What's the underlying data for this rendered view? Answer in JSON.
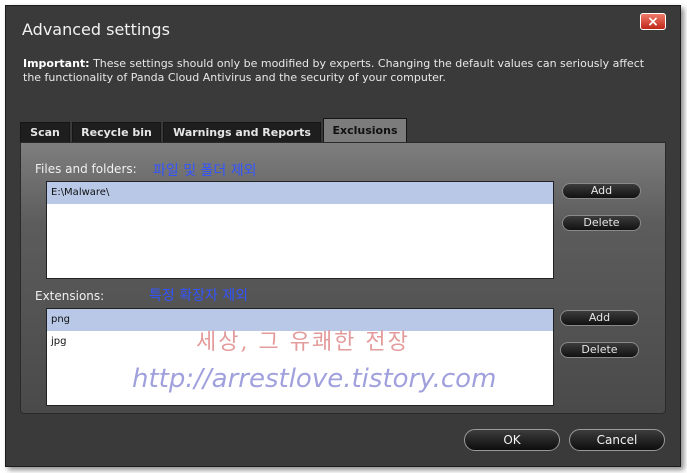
{
  "window": {
    "title": "Advanced settings",
    "close_label": "×"
  },
  "notice": {
    "bold": "Important:",
    "text": " These settings should only be modified by experts. Changing the default values can seriously affect the functionality of Panda Cloud Antivirus and the security of your computer."
  },
  "tabs": [
    {
      "label": "Scan"
    },
    {
      "label": "Recycle bin"
    },
    {
      "label": "Warnings and Reports"
    },
    {
      "label": "Exclusions"
    }
  ],
  "files": {
    "label": "Files and folders:",
    "annotation": "파일 및 폴더 제외",
    "items": [
      "E:\\Malware\\"
    ],
    "add_label": "Add",
    "delete_label": "Delete"
  },
  "extensions": {
    "label": "Extensions:",
    "annotation": "특정 확장자 제외",
    "items": [
      "png",
      "jpg"
    ],
    "add_label": "Add",
    "delete_label": "Delete"
  },
  "watermark": {
    "line1": "세상, 그 유쾌한 전장",
    "line2": "http://arrestlove.tistory.com"
  },
  "footer": {
    "ok_label": "OK",
    "cancel_label": "Cancel"
  },
  "colors": {
    "selection": "#b8c8e6",
    "annotation_blue": "#3355ff",
    "close_red": "#d0362a"
  }
}
